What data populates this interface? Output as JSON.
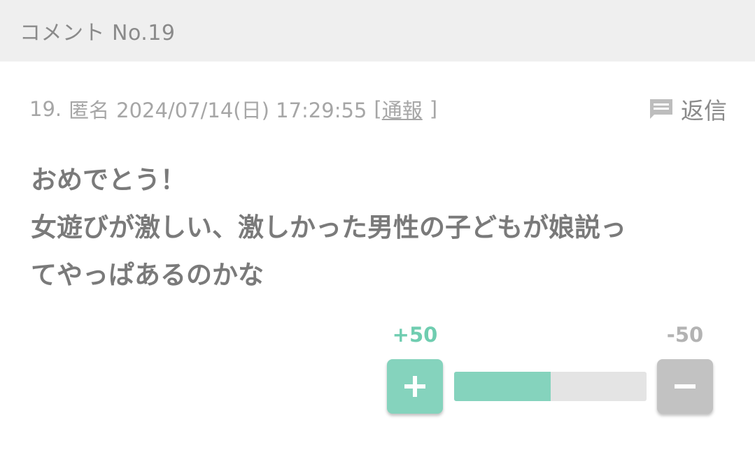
{
  "header": {
    "title": "コメント No.19"
  },
  "comment": {
    "number": "19.",
    "author": "匿名",
    "datetime": "2024/07/14(日) 17:29:55",
    "report_open": "[",
    "report_label": "通報",
    "report_close": "]",
    "reply_label": "返信",
    "reply_icon": "comment-icon",
    "body_lines": [
      "おめでとう！",
      "女遊びが激しい、激しかった男性の子どもが娘説っ",
      "てやっぱあるのかな"
    ]
  },
  "votes": {
    "plus_count": "+50",
    "minus_count": "-50",
    "plus_fraction": 0.5,
    "plus_icon": "plus-icon",
    "minus_icon": "minus-icon"
  },
  "colors": {
    "accent": "#85d3bd",
    "plus_text": "#6fcdb0",
    "minus": "#c2c2c2",
    "header_bg": "#efefef"
  }
}
